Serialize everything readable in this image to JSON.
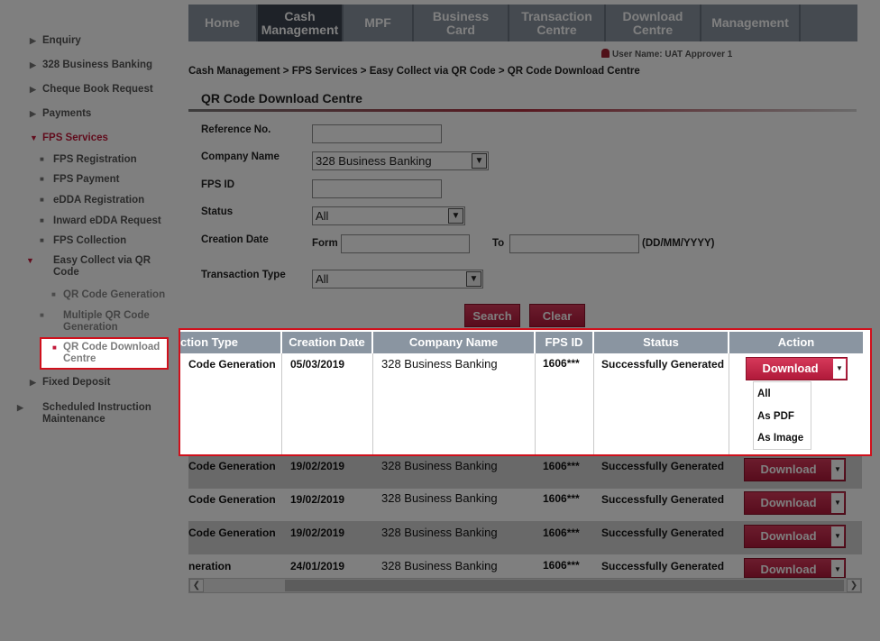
{
  "sidebar": {
    "items": [
      {
        "label": "Enquiry"
      },
      {
        "label": "328 Business Banking"
      },
      {
        "label": "Cheque Book Request"
      },
      {
        "label": "Payments"
      },
      {
        "label": "FPS Services"
      },
      {
        "label": "Fixed Deposit"
      },
      {
        "label": "Scheduled Instruction Maintenance"
      }
    ],
    "fps_sub": [
      {
        "label": "FPS Registration"
      },
      {
        "label": "FPS Payment"
      },
      {
        "label": "eDDA Registration"
      },
      {
        "label": "Inward eDDA Request"
      },
      {
        "label": "FPS Collection"
      },
      {
        "label": "Easy Collect via QR Code"
      }
    ],
    "qr_sub": [
      {
        "label": "QR Code Generation"
      },
      {
        "label": "Multiple QR Code Generation"
      },
      {
        "label": "QR Code Download Centre"
      }
    ]
  },
  "nav": {
    "tabs": [
      {
        "label": "Home"
      },
      {
        "label": "Cash Management"
      },
      {
        "label": "MPF"
      },
      {
        "label": "Business Card"
      },
      {
        "label": "Transaction Centre"
      },
      {
        "label": "Download Centre"
      },
      {
        "label": "Management"
      }
    ]
  },
  "user": {
    "label": "User Name: UAT Approver 1"
  },
  "breadcrumb": "Cash Management > FPS Services > Easy Collect via QR Code > QR Code Download Centre",
  "page_title": "QR Code Download Centre",
  "form": {
    "reference_label": "Reference No.",
    "reference_value": "",
    "company_label": "Company Name",
    "company_value": "328 Business Banking",
    "fpsid_label": "FPS ID",
    "fpsid_value": "",
    "status_label": "Status",
    "status_value": "All",
    "creation_label": "Creation Date",
    "from_label": "Form",
    "to_label": "To",
    "date_format": "(DD/MM/YYYY)",
    "txn_type_label": "Transaction Type",
    "txn_type_value": "All",
    "search_button": "Search",
    "clear_button": "Clear"
  },
  "table": {
    "headers": [
      "ction Type",
      "Creation Date",
      "Company Name",
      "FPS ID",
      "Status",
      "Action"
    ],
    "rows": [
      {
        "type": "Code Generation",
        "date": "05/03/2019",
        "company": "328 Business Banking",
        "fps_id": "1606***",
        "status": "Successfully Generated",
        "action": "Download"
      },
      {
        "type": "Code Generation",
        "date": "19/02/2019",
        "company": "328 Business Banking",
        "fps_id": "1606***",
        "status": "Successfully Generated",
        "action": "Download"
      },
      {
        "type": "Code Generation",
        "date": "19/02/2019",
        "company": "328 Business Banking",
        "fps_id": "1606***",
        "status": "Successfully Generated",
        "action": "Download"
      },
      {
        "type": "Code Generation",
        "date": "19/02/2019",
        "company": "328 Business Banking",
        "fps_id": "1606***",
        "status": "Successfully Generated",
        "action": "Download"
      },
      {
        "type": "neration",
        "date": "24/01/2019",
        "company": "328 Business Banking",
        "fps_id": "1606***",
        "status": "Successfully Generated",
        "action": "Download"
      }
    ],
    "download_menu": [
      "All",
      "As PDF",
      "As Image"
    ]
  },
  "colors": {
    "accent": "#c31a3b",
    "nav_bg": "#8a95a1",
    "nav_active": "#3c4550",
    "highlight_border": "#d0101c"
  }
}
